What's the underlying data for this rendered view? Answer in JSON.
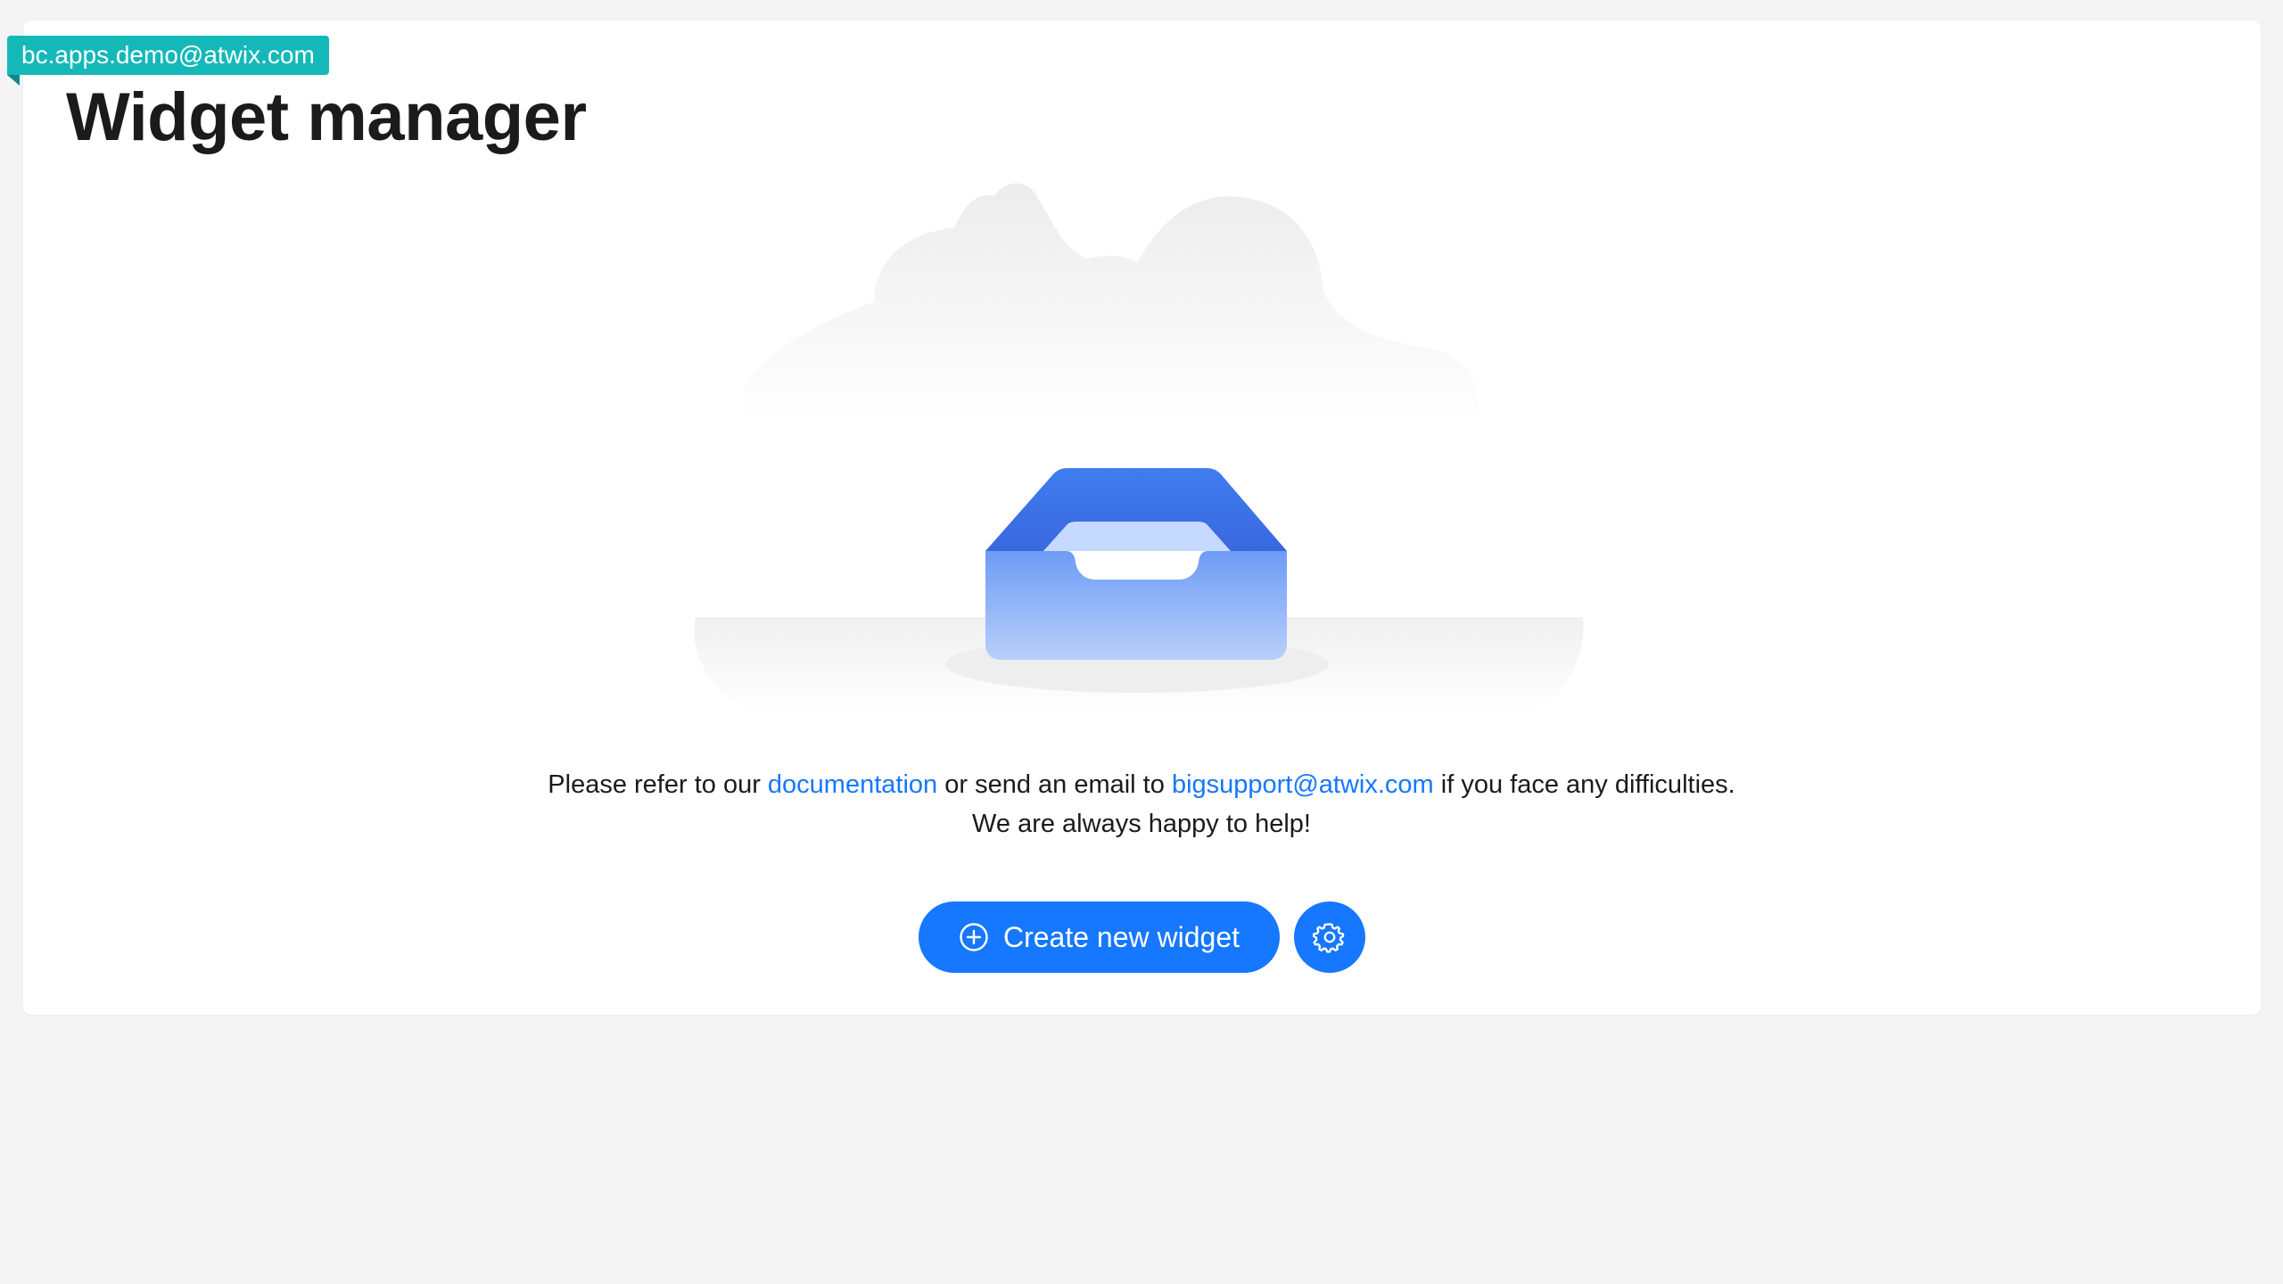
{
  "account": {
    "email": "bc.apps.demo@atwix.com"
  },
  "header": {
    "title": "Widget manager"
  },
  "empty_state": {
    "illustration_icon": "empty-inbox-icon",
    "line1_prefix": "Please refer to our ",
    "documentation_link": "documentation",
    "line1_middle": " or send an email to ",
    "support_email_link": "bigsupport@atwix.com",
    "line1_suffix": " if you face any difficulties.",
    "line2": "We are always happy to help!"
  },
  "actions": {
    "create_label": "Create new widget",
    "create_icon": "plus-circle-icon",
    "settings_icon": "gear-icon"
  },
  "colors": {
    "accent": "#1677ff",
    "badge": "#15b8b8",
    "background": "#f4f4f4",
    "card": "#ffffff",
    "text": "#1b1b1b"
  }
}
